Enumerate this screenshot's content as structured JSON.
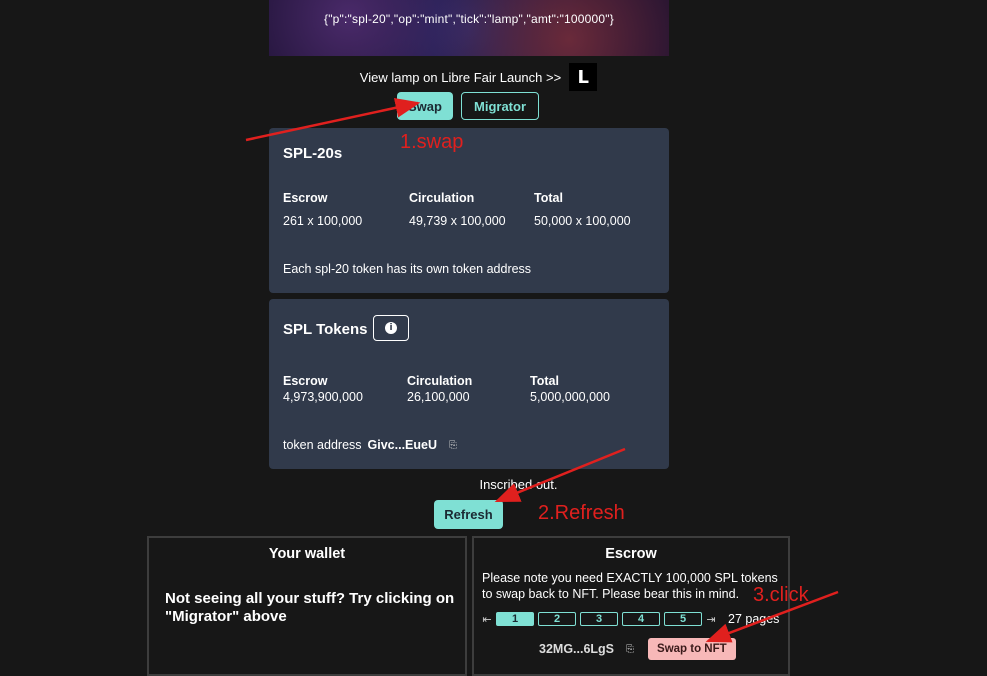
{
  "banner": {
    "inscription_text": "{\"p\":\"spl-20\",\"op\":\"mint\",\"tick\":\"lamp\",\"amt\":\"100000\"}"
  },
  "fair_launch": {
    "label": "View lamp on Libre Fair Launch >>",
    "logo_glyph": "L"
  },
  "tabs": {
    "swap": "Swap",
    "migrator": "Migrator"
  },
  "spl20": {
    "title": "SPL-20s",
    "stats": [
      {
        "label": "Escrow",
        "value": "261 x 100,000"
      },
      {
        "label": "Circulation",
        "value": "49,739 x 100,000"
      },
      {
        "label": "Total",
        "value": "50,000 x 100,000"
      }
    ],
    "note": "Each spl-20 token has its own token address"
  },
  "spl_tokens": {
    "title": "SPL Tokens",
    "info_icon": "i",
    "stats": [
      {
        "label": "Escrow",
        "value": "4,973,900,000"
      },
      {
        "label": "Circulation",
        "value": "26,100,000"
      },
      {
        "label": "Total",
        "value": "5,000,000,000"
      }
    ],
    "address_label": "token address",
    "address": "Givc...EueU",
    "copy_icon": "⎘"
  },
  "status": {
    "inscribed": "Inscribed out."
  },
  "refresh_label": "Refresh",
  "wallet": {
    "title": "Your wallet",
    "message": "Not seeing all your stuff? Try clicking on \"Migrator\" above"
  },
  "escrow": {
    "title": "Escrow",
    "note": "Please note you need EXACTLY 100,000 SPL tokens to swap back to NFT. Please bear this in mind.",
    "pages": [
      "1",
      "2",
      "3",
      "4",
      "5"
    ],
    "active_page": "1",
    "total_pages": "27 pages",
    "first_icon": "⇤",
    "last_icon": "⇥",
    "nft_address": "32MG...6LgS",
    "swap_button": "Swap to NFT"
  },
  "annotations": {
    "step1": "1.swap",
    "step2": "2.Refresh",
    "step3": "3.click"
  },
  "colors": {
    "accent": "#7fe0d4",
    "card_bg": "#313a4b",
    "page_bg": "#171717",
    "annotation": "#e0201e",
    "swap_nft_bg": "#f7b8b8"
  }
}
